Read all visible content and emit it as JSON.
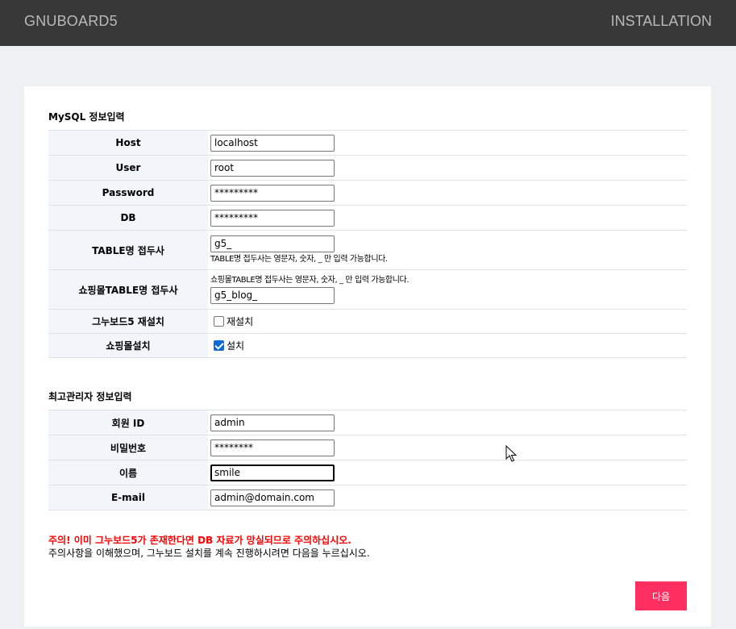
{
  "header": {
    "brand": "GNUBOARD5",
    "step": "INSTALLATION"
  },
  "mysql": {
    "title": "MySQL 정보입력",
    "host": {
      "label": "Host",
      "value": "localhost"
    },
    "user": {
      "label": "User",
      "value": "root"
    },
    "password": {
      "label": "Password",
      "value": "*********"
    },
    "db": {
      "label": "DB",
      "value": "*********"
    },
    "table_prefix": {
      "label": "TABLE명 접두사",
      "value": "g5_",
      "help": "TABLE명 접두사는 영문자, 숫자, _ 만 입력 가능합니다."
    },
    "shop_prefix": {
      "label": "쇼핑몰TABLE명 접두사",
      "value": "g5_blog_",
      "help": "쇼핑몰TABLE명 접두사는 영문자, 숫자, _ 만 입력 가능합니다."
    },
    "reinstall": {
      "label": "그누보드5 재설치",
      "option": "재설치",
      "checked": false
    },
    "shop_install": {
      "label": "쇼핑몰설치",
      "option": "설치",
      "checked": true
    }
  },
  "admin": {
    "title": "최고관리자 정보입력",
    "id": {
      "label": "회원 ID",
      "value": "admin"
    },
    "password": {
      "label": "비밀번호",
      "value": "********"
    },
    "name": {
      "label": "이름",
      "value": "smile"
    },
    "email": {
      "label": "E-mail",
      "value": "admin@domain.com"
    }
  },
  "warning": "주의! 이미 그누보드5가 존재한다면 DB 자료가 망실되므로 주의하십시오.",
  "notice": "주의사항을 이해했으며, 그누보드 설치를 계속 진행하시려면 다음을 누르십시오.",
  "next_label": "다음",
  "colors": {
    "header_bg": "#383838",
    "accent": "#ff3061",
    "warning": "#ff0000"
  }
}
